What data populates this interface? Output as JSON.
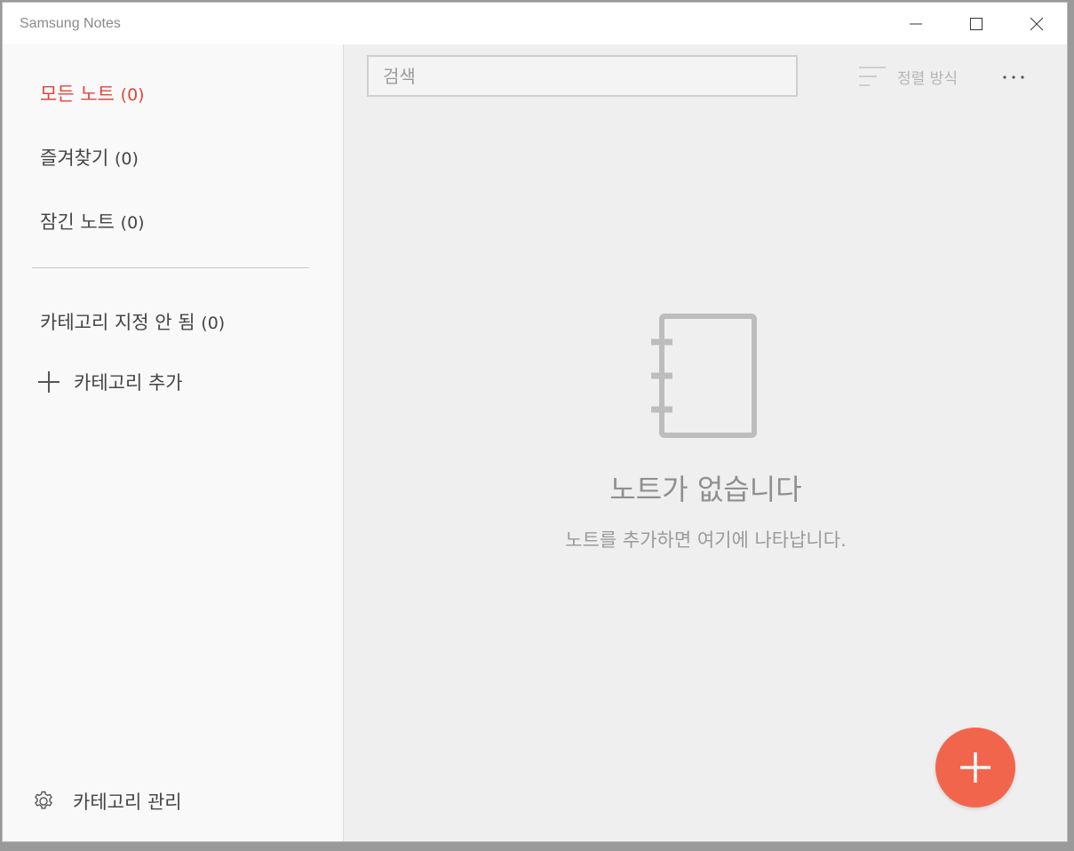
{
  "window": {
    "title": "Samsung Notes"
  },
  "sidebar": {
    "items": [
      {
        "label": "모든 노트",
        "count": "(0)"
      },
      {
        "label": "즐겨찾기",
        "count": "(0)"
      },
      {
        "label": "잠긴 노트",
        "count": "(0)"
      },
      {
        "label": "카테고리 지정 안 됨",
        "count": "(0)"
      }
    ],
    "add_category_label": "카테고리 추가",
    "manage_category_label": "카테고리 관리"
  },
  "toolbar": {
    "search_placeholder": "검색",
    "sort_label": "정렬 방식"
  },
  "empty_state": {
    "title": "노트가 없습니다",
    "subtitle": "노트를 추가하면 여기에 나타납니다."
  },
  "icons": {
    "minimize": "minimize-icon",
    "maximize": "maximize-icon",
    "close": "close-icon",
    "add": "plus-icon",
    "settings": "gear-icon",
    "sort": "sort-lines-icon",
    "more": "more-dots-icon",
    "notebook": "notebook-icon",
    "fab": "plus-icon"
  },
  "colors": {
    "accent": "#e2463b",
    "fab": "#f2654d"
  }
}
